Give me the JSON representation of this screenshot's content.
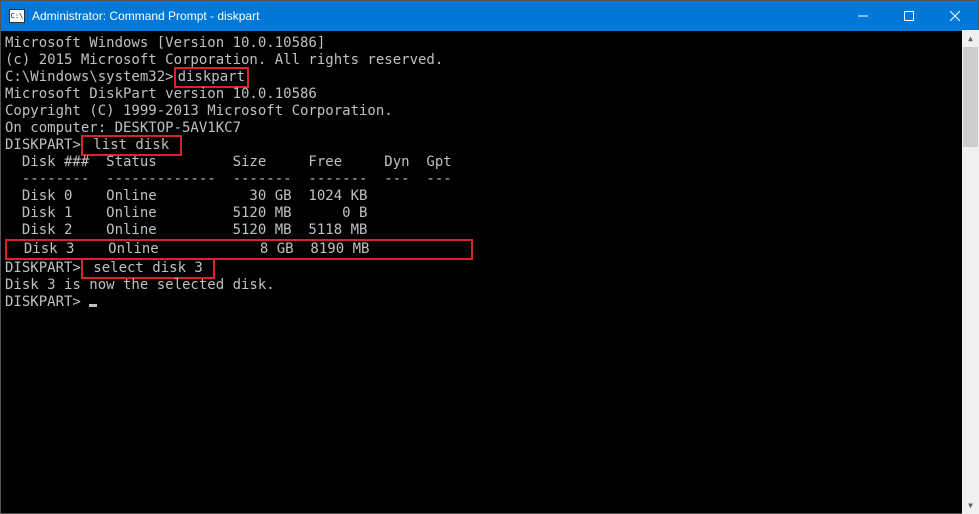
{
  "titlebar": {
    "title": "Administrator: Command Prompt - diskpart"
  },
  "lines": {
    "l0": "Microsoft Windows [Version 10.0.10586]",
    "l1": "(c) 2015 Microsoft Corporation. All rights reserved.",
    "l2": "",
    "prompt1_pre": "C:\\Windows\\system32>",
    "prompt1_cmd": "diskpart",
    "l4": "",
    "l5": "Microsoft DiskPart version 10.0.10586",
    "l6": "",
    "l7": "Copyright (C) 1999-2013 Microsoft Corporation.",
    "l8": "On computer: DESKTOP-5AV1KC7",
    "l9": "",
    "prompt2_pre": "DISKPART>",
    "prompt2_cmd": " list disk ",
    "l11": "",
    "header": "  Disk ###  Status         Size     Free     Dyn  Gpt",
    "divider": "  --------  -------------  -------  -------  ---  ---",
    "r0": "  Disk 0    Online           30 GB  1024 KB",
    "r1": "  Disk 1    Online         5120 MB      0 B",
    "r2": "  Disk 2    Online         5120 MB  5118 MB",
    "r3": "  Disk 3    Online            8 GB  8190 MB            ",
    "l18": "",
    "prompt3_pre": "DISKPART>",
    "prompt3_cmd": " select disk 3 ",
    "l20": "",
    "l21": "Disk 3 is now the selected disk.",
    "l22": "",
    "prompt4_pre": "DISKPART> "
  }
}
